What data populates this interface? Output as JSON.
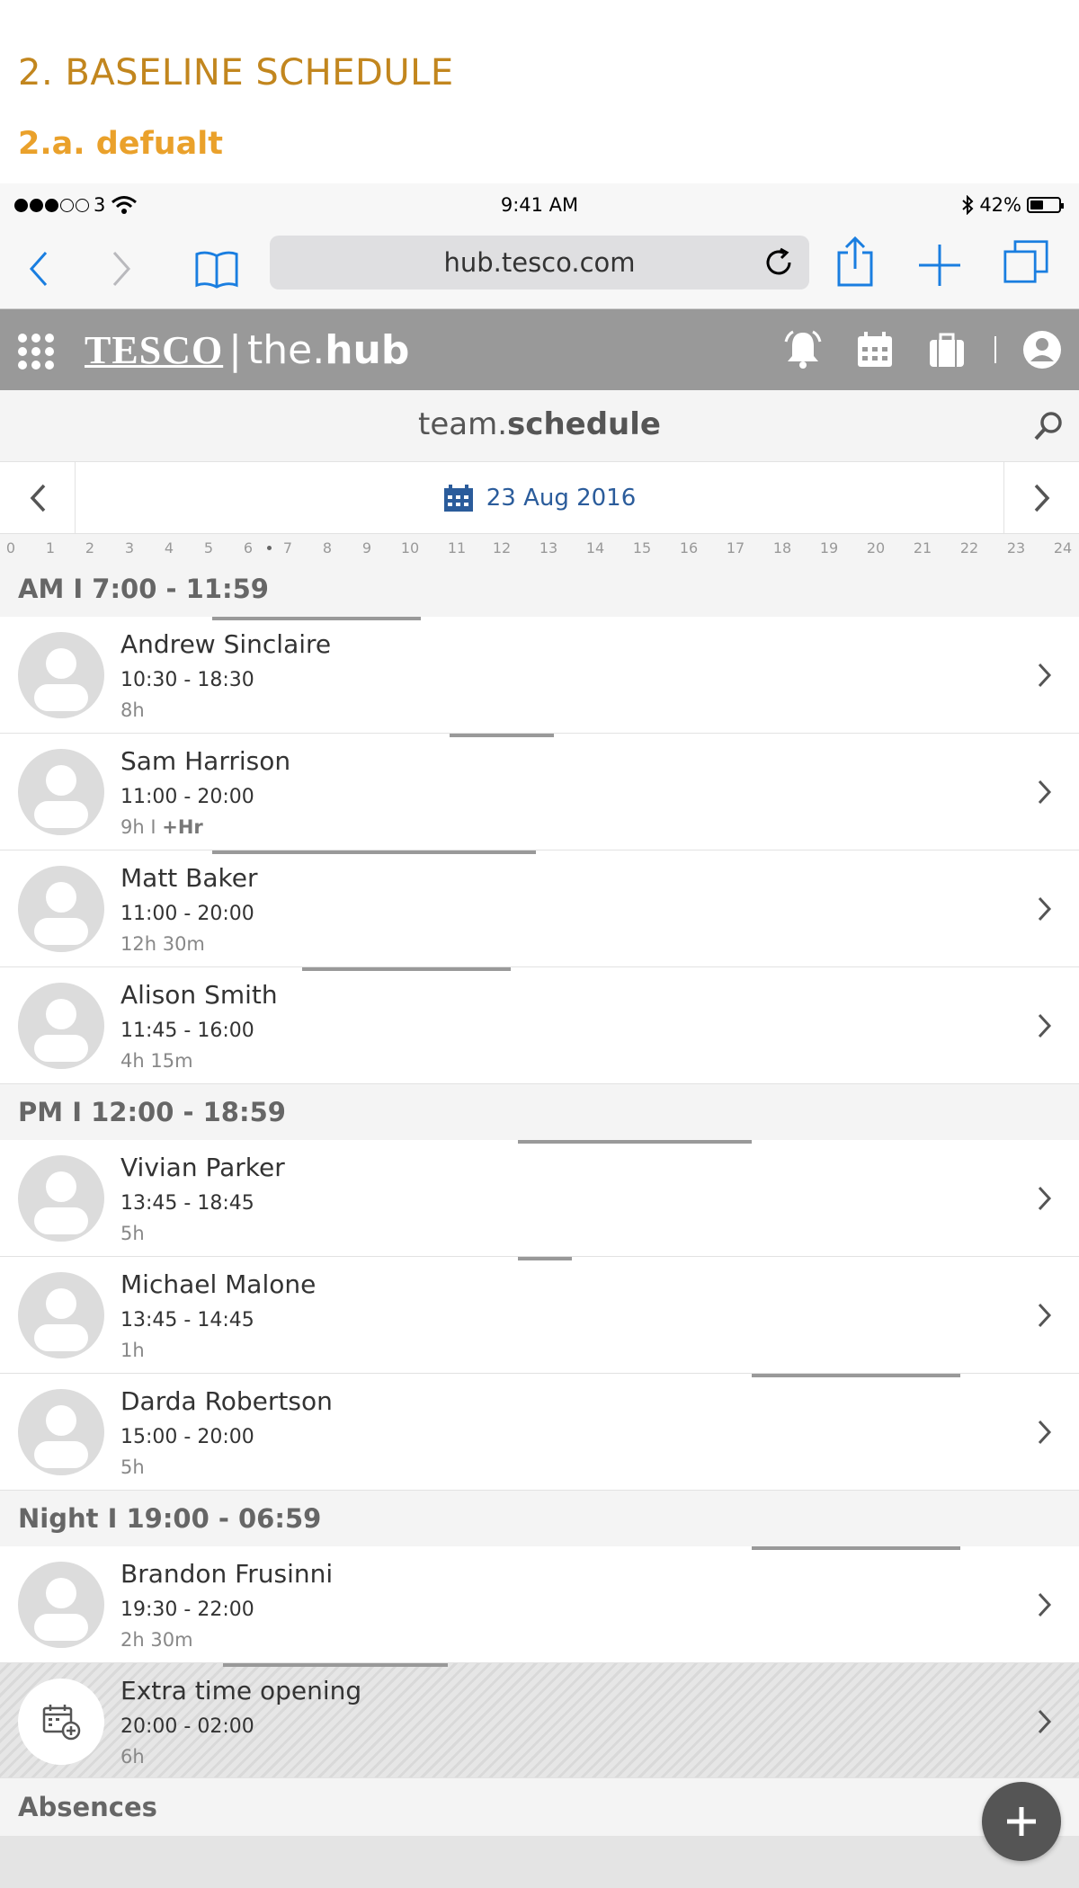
{
  "doc": {
    "title": "2. BASELINE SCHEDULE",
    "subtitle": "2.a. defualt"
  },
  "status_bar": {
    "carrier": "3",
    "time": "9:41 AM",
    "battery": "42%"
  },
  "browser": {
    "url": "hub.tesco.com"
  },
  "app": {
    "brand_tesco": "TESCO",
    "brand_divider": "|",
    "brand_the": "the.",
    "brand_hub": "hub"
  },
  "page": {
    "title_light": "team.",
    "title_bold": "schedule"
  },
  "date_nav": {
    "date": "23 Aug 2016"
  },
  "timeline": {
    "hours": [
      "0",
      "1",
      "2",
      "3",
      "4",
      "5",
      "6",
      "7",
      "8",
      "9",
      "10",
      "11",
      "12",
      "13",
      "14",
      "15",
      "16",
      "17",
      "18",
      "19",
      "20",
      "21",
      "22",
      "23",
      "24"
    ]
  },
  "sections": {
    "am": "AM I 7:00 - 11:59",
    "pm": "PM I 12:00 - 18:59",
    "night": "Night I 19:00 - 06:59",
    "absences": "Absences"
  },
  "rows": [
    {
      "name": "Andrew Sinclaire",
      "time": "10:30 - 18:30",
      "duration": "8h"
    },
    {
      "name": "Sam Harrison",
      "time": "11:00 - 20:00",
      "duration": "9h I ",
      "extra": "+Hr"
    },
    {
      "name": "Matt Baker",
      "time": "11:00 - 20:00",
      "duration": "12h 30m"
    },
    {
      "name": "Alison Smith",
      "time": "11:45 - 16:00",
      "duration": "4h 15m"
    },
    {
      "name": "Vivian Parker",
      "time": "13:45 - 18:45",
      "duration": "5h"
    },
    {
      "name": "Michael Malone",
      "time": "13:45 - 14:45",
      "duration": "1h"
    },
    {
      "name": "Darda Robertson",
      "time": "15:00 - 20:00",
      "duration": "5h"
    },
    {
      "name": "Brandon Frusinni",
      "time": "19:30 - 22:00",
      "duration": "2h 30m"
    },
    {
      "name": "Extra time opening",
      "time": "20:00 - 02:00",
      "duration": "6h"
    }
  ],
  "colors": {
    "doc_title": "#c2861e",
    "doc_subtitle": "#eaa12b",
    "ios_blue": "#1a7ee0",
    "app_header": "#999999",
    "date_blue": "#2b5c9b"
  }
}
